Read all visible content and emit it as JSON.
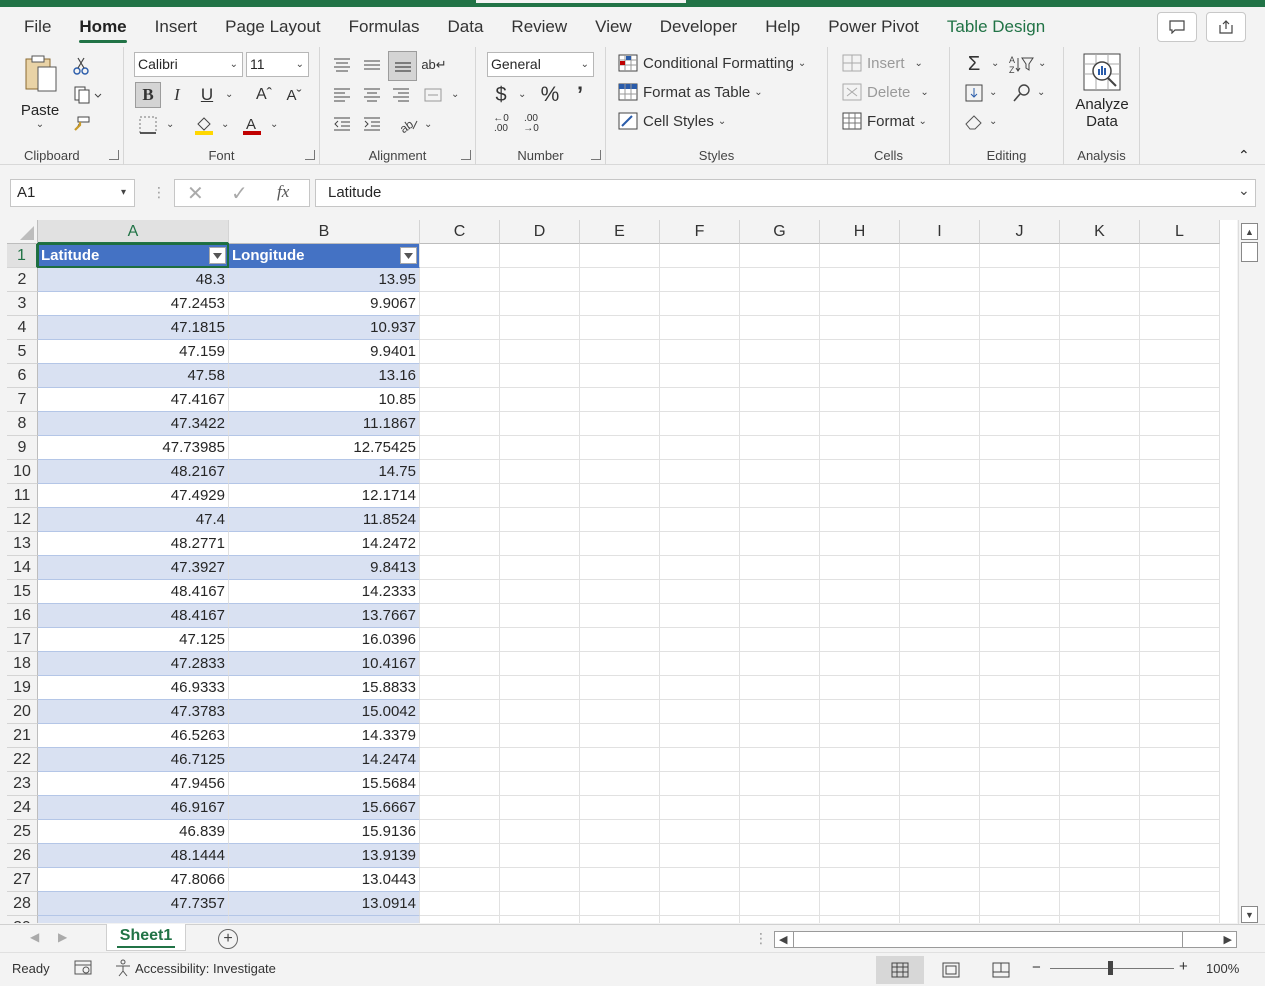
{
  "tabs": [
    "File",
    "Home",
    "Insert",
    "Page Layout",
    "Formulas",
    "Data",
    "Review",
    "View",
    "Developer",
    "Help",
    "Power Pivot",
    "Table Design"
  ],
  "ribbon": {
    "clipboard": {
      "label": "Clipboard",
      "paste": "Paste"
    },
    "font": {
      "label": "Font",
      "name": "Calibri",
      "size": "11"
    },
    "alignment": {
      "label": "Alignment"
    },
    "number": {
      "label": "Number",
      "format": "General"
    },
    "styles": {
      "label": "Styles",
      "conditional": "Conditional Formatting",
      "format_table": "Format as Table",
      "cell_styles": "Cell Styles"
    },
    "cells": {
      "label": "Cells",
      "insert": "Insert",
      "delete": "Delete",
      "format": "Format"
    },
    "editing": {
      "label": "Editing"
    },
    "analysis": {
      "label": "Analysis",
      "analyze_line1": "Analyze",
      "analyze_line2": "Data"
    }
  },
  "formula_bar": {
    "name_box": "A1",
    "content": "Latitude"
  },
  "columns": [
    "A",
    "B",
    "C",
    "D",
    "E",
    "F",
    "G",
    "H",
    "I",
    "J",
    "K",
    "L"
  ],
  "table": {
    "headers": [
      "Latitude",
      "Longitude"
    ],
    "rows": [
      [
        "48.3",
        "13.95"
      ],
      [
        "47.2453",
        "9.9067"
      ],
      [
        "47.1815",
        "10.937"
      ],
      [
        "47.159",
        "9.9401"
      ],
      [
        "47.58",
        "13.16"
      ],
      [
        "47.4167",
        "10.85"
      ],
      [
        "47.3422",
        "11.1867"
      ],
      [
        "47.73985",
        "12.75425"
      ],
      [
        "48.2167",
        "14.75"
      ],
      [
        "47.4929",
        "12.1714"
      ],
      [
        "47.4",
        "11.8524"
      ],
      [
        "48.2771",
        "14.2472"
      ],
      [
        "47.3927",
        "9.8413"
      ],
      [
        "48.4167",
        "14.2333"
      ],
      [
        "48.4167",
        "13.7667"
      ],
      [
        "47.125",
        "16.0396"
      ],
      [
        "47.2833",
        "10.4167"
      ],
      [
        "46.9333",
        "15.8833"
      ],
      [
        "47.3783",
        "15.0042"
      ],
      [
        "46.5263",
        "14.3379"
      ],
      [
        "46.7125",
        "14.2474"
      ],
      [
        "47.9456",
        "15.5684"
      ],
      [
        "46.9167",
        "15.6667"
      ],
      [
        "46.839",
        "15.9136"
      ],
      [
        "48.1444",
        "13.9139"
      ],
      [
        "47.8066",
        "13.0443"
      ],
      [
        "47.7357",
        "13.0914"
      ]
    ]
  },
  "sheet_tab": "Sheet1",
  "status": {
    "ready": "Ready",
    "accessibility": "Accessibility: Investigate",
    "zoom": "100%"
  },
  "colors": {
    "accent": "#217346",
    "table_header": "#4472c4",
    "table_band": "#d9e1f2"
  }
}
